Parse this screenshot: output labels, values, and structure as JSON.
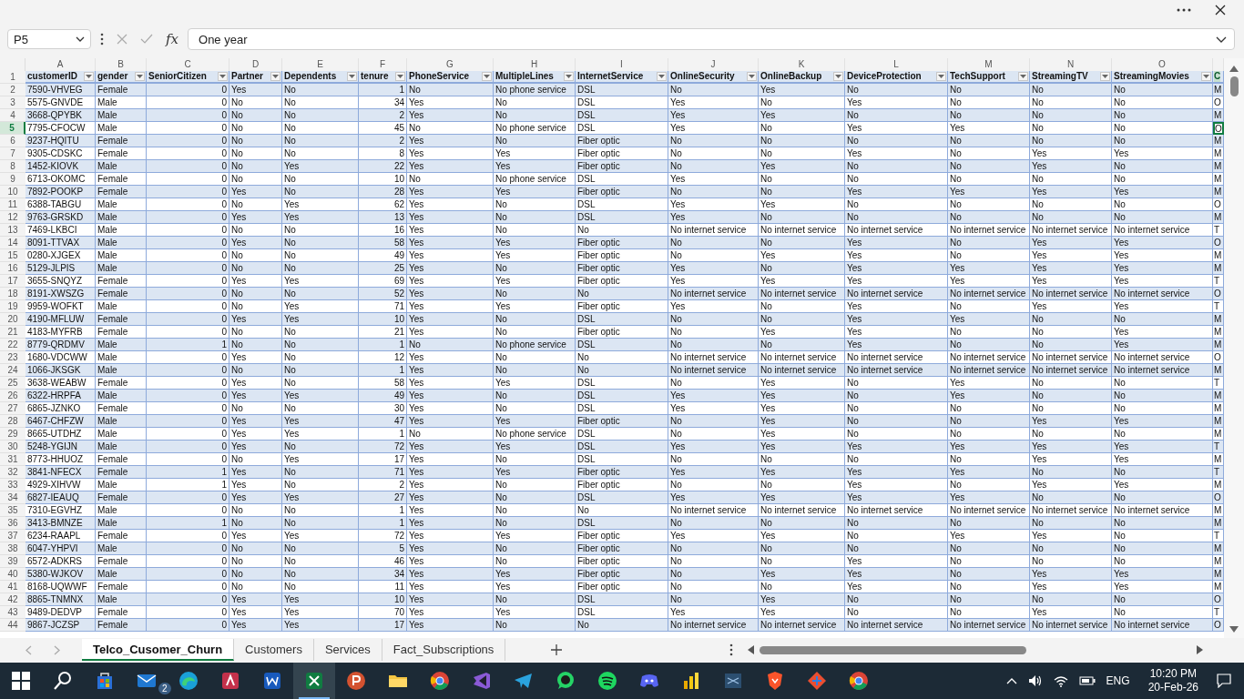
{
  "formula_bar": {
    "name_box": "P5",
    "function_label": "fx",
    "value": "One year"
  },
  "columns": [
    {
      "letter": "A",
      "header": "customerID",
      "filter_button": true,
      "selected": false
    },
    {
      "letter": "B",
      "header": "gender",
      "filter_button": true,
      "selected": false
    },
    {
      "letter": "C",
      "header": "SeniorCitizen",
      "filter_button": true,
      "selected": false
    },
    {
      "letter": "D",
      "header": "Partner",
      "filter_button": true,
      "selected": false
    },
    {
      "letter": "E",
      "header": "Dependents",
      "filter_button": true,
      "selected": false
    },
    {
      "letter": "F",
      "header": "tenure",
      "filter_button": true,
      "selected": false
    },
    {
      "letter": "G",
      "header": "PhoneService",
      "filter_button": true,
      "selected": false
    },
    {
      "letter": "H",
      "header": "MultipleLines",
      "filter_button": true,
      "selected": false
    },
    {
      "letter": "I",
      "header": "InternetService",
      "filter_button": true,
      "selected": false
    },
    {
      "letter": "J",
      "header": "OnlineSecurity",
      "filter_button": true,
      "selected": false
    },
    {
      "letter": "K",
      "header": "OnlineBackup",
      "filter_button": true,
      "selected": false
    },
    {
      "letter": "L",
      "header": "DeviceProtection",
      "filter_button": true,
      "selected": false
    },
    {
      "letter": "M",
      "header": "TechSupport",
      "filter_button": true,
      "selected": false
    },
    {
      "letter": "N",
      "header": "StreamingTV",
      "filter_button": true,
      "selected": false
    },
    {
      "letter": "O",
      "header": "StreamingMovies",
      "filter_button": true,
      "selected": false
    },
    {
      "header": "C",
      "filter_button": false,
      "selected": true
    }
  ],
  "header_row_number": "1",
  "rows": [
    {
      "number": "2",
      "selected": false,
      "cells": [
        "7590-VHVEG",
        "Female",
        "0",
        "Yes",
        "No",
        "1",
        "No",
        "No phone service",
        "DSL",
        "No",
        "Yes",
        "No",
        "No",
        "No",
        "No",
        "M"
      ]
    },
    {
      "number": "3",
      "selected": false,
      "cells": [
        "5575-GNVDE",
        "Male",
        "0",
        "No",
        "No",
        "34",
        "Yes",
        "No",
        "DSL",
        "Yes",
        "No",
        "Yes",
        "No",
        "No",
        "No",
        "O"
      ]
    },
    {
      "number": "4",
      "selected": false,
      "cells": [
        "3668-QPYBK",
        "Male",
        "0",
        "No",
        "No",
        "2",
        "Yes",
        "No",
        "DSL",
        "Yes",
        "Yes",
        "No",
        "No",
        "No",
        "No",
        "M"
      ]
    },
    {
      "number": "5",
      "selected": true,
      "cells": [
        "7795-CFOCW",
        "Male",
        "0",
        "No",
        "No",
        "45",
        "No",
        "No phone service",
        "DSL",
        "Yes",
        "No",
        "Yes",
        "Yes",
        "No",
        "No",
        "O"
      ]
    },
    {
      "number": "6",
      "selected": false,
      "cells": [
        "9237-HQITU",
        "Female",
        "0",
        "No",
        "No",
        "2",
        "Yes",
        "No",
        "Fiber optic",
        "No",
        "No",
        "No",
        "No",
        "No",
        "No",
        "M"
      ]
    },
    {
      "number": "7",
      "selected": false,
      "cells": [
        "9305-CDSKC",
        "Female",
        "0",
        "No",
        "No",
        "8",
        "Yes",
        "Yes",
        "Fiber optic",
        "No",
        "No",
        "Yes",
        "No",
        "Yes",
        "Yes",
        "M"
      ]
    },
    {
      "number": "8",
      "selected": false,
      "cells": [
        "1452-KIOVK",
        "Male",
        "0",
        "No",
        "Yes",
        "22",
        "Yes",
        "Yes",
        "Fiber optic",
        "No",
        "Yes",
        "No",
        "No",
        "Yes",
        "No",
        "M"
      ]
    },
    {
      "number": "9",
      "selected": false,
      "cells": [
        "6713-OKOMC",
        "Female",
        "0",
        "No",
        "No",
        "10",
        "No",
        "No phone service",
        "DSL",
        "Yes",
        "No",
        "No",
        "No",
        "No",
        "No",
        "M"
      ]
    },
    {
      "number": "10",
      "selected": false,
      "cells": [
        "7892-POOKP",
        "Female",
        "0",
        "Yes",
        "No",
        "28",
        "Yes",
        "Yes",
        "Fiber optic",
        "No",
        "No",
        "Yes",
        "Yes",
        "Yes",
        "Yes",
        "M"
      ]
    },
    {
      "number": "11",
      "selected": false,
      "cells": [
        "6388-TABGU",
        "Male",
        "0",
        "No",
        "Yes",
        "62",
        "Yes",
        "No",
        "DSL",
        "Yes",
        "Yes",
        "No",
        "No",
        "No",
        "No",
        "O"
      ]
    },
    {
      "number": "12",
      "selected": false,
      "cells": [
        "9763-GRSKD",
        "Male",
        "0",
        "Yes",
        "Yes",
        "13",
        "Yes",
        "No",
        "DSL",
        "Yes",
        "No",
        "No",
        "No",
        "No",
        "No",
        "M"
      ]
    },
    {
      "number": "13",
      "selected": false,
      "cells": [
        "7469-LKBCI",
        "Male",
        "0",
        "No",
        "No",
        "16",
        "Yes",
        "No",
        "No",
        "No internet service",
        "No internet service",
        "No internet service",
        "No internet service",
        "No internet service",
        "No internet service",
        "T"
      ]
    },
    {
      "number": "14",
      "selected": false,
      "cells": [
        "8091-TTVAX",
        "Male",
        "0",
        "Yes",
        "No",
        "58",
        "Yes",
        "Yes",
        "Fiber optic",
        "No",
        "No",
        "Yes",
        "No",
        "Yes",
        "Yes",
        "O"
      ]
    },
    {
      "number": "15",
      "selected": false,
      "cells": [
        "0280-XJGEX",
        "Male",
        "0",
        "No",
        "No",
        "49",
        "Yes",
        "Yes",
        "Fiber optic",
        "No",
        "Yes",
        "Yes",
        "No",
        "Yes",
        "Yes",
        "M"
      ]
    },
    {
      "number": "16",
      "selected": false,
      "cells": [
        "5129-JLPIS",
        "Male",
        "0",
        "No",
        "No",
        "25",
        "Yes",
        "No",
        "Fiber optic",
        "Yes",
        "No",
        "Yes",
        "Yes",
        "Yes",
        "Yes",
        "M"
      ]
    },
    {
      "number": "17",
      "selected": false,
      "cells": [
        "3655-SNQYZ",
        "Female",
        "0",
        "Yes",
        "Yes",
        "69",
        "Yes",
        "Yes",
        "Fiber optic",
        "Yes",
        "Yes",
        "Yes",
        "Yes",
        "Yes",
        "Yes",
        "T"
      ]
    },
    {
      "number": "18",
      "selected": false,
      "cells": [
        "8191-XWSZG",
        "Female",
        "0",
        "No",
        "No",
        "52",
        "Yes",
        "No",
        "No",
        "No internet service",
        "No internet service",
        "No internet service",
        "No internet service",
        "No internet service",
        "No internet service",
        "O"
      ]
    },
    {
      "number": "19",
      "selected": false,
      "cells": [
        "9959-WOFKT",
        "Male",
        "0",
        "No",
        "Yes",
        "71",
        "Yes",
        "Yes",
        "Fiber optic",
        "Yes",
        "No",
        "Yes",
        "No",
        "Yes",
        "Yes",
        "T"
      ]
    },
    {
      "number": "20",
      "selected": false,
      "cells": [
        "4190-MFLUW",
        "Female",
        "0",
        "Yes",
        "Yes",
        "10",
        "Yes",
        "No",
        "DSL",
        "No",
        "No",
        "Yes",
        "Yes",
        "No",
        "No",
        "M"
      ]
    },
    {
      "number": "21",
      "selected": false,
      "cells": [
        "4183-MYFRB",
        "Female",
        "0",
        "No",
        "No",
        "21",
        "Yes",
        "No",
        "Fiber optic",
        "No",
        "Yes",
        "Yes",
        "No",
        "No",
        "Yes",
        "M"
      ]
    },
    {
      "number": "22",
      "selected": false,
      "cells": [
        "8779-QRDMV",
        "Male",
        "1",
        "No",
        "No",
        "1",
        "No",
        "No phone service",
        "DSL",
        "No",
        "No",
        "Yes",
        "No",
        "No",
        "Yes",
        "M"
      ]
    },
    {
      "number": "23",
      "selected": false,
      "cells": [
        "1680-VDCWW",
        "Male",
        "0",
        "Yes",
        "No",
        "12",
        "Yes",
        "No",
        "No",
        "No internet service",
        "No internet service",
        "No internet service",
        "No internet service",
        "No internet service",
        "No internet service",
        "O"
      ]
    },
    {
      "number": "24",
      "selected": false,
      "cells": [
        "1066-JKSGK",
        "Male",
        "0",
        "No",
        "No",
        "1",
        "Yes",
        "No",
        "No",
        "No internet service",
        "No internet service",
        "No internet service",
        "No internet service",
        "No internet service",
        "No internet service",
        "M"
      ]
    },
    {
      "number": "25",
      "selected": false,
      "cells": [
        "3638-WEABW",
        "Female",
        "0",
        "Yes",
        "No",
        "58",
        "Yes",
        "Yes",
        "DSL",
        "No",
        "Yes",
        "No",
        "Yes",
        "No",
        "No",
        "T"
      ]
    },
    {
      "number": "26",
      "selected": false,
      "cells": [
        "6322-HRPFA",
        "Male",
        "0",
        "Yes",
        "Yes",
        "49",
        "Yes",
        "No",
        "DSL",
        "Yes",
        "Yes",
        "No",
        "Yes",
        "No",
        "No",
        "M"
      ]
    },
    {
      "number": "27",
      "selected": false,
      "cells": [
        "6865-JZNKO",
        "Female",
        "0",
        "No",
        "No",
        "30",
        "Yes",
        "No",
        "DSL",
        "Yes",
        "Yes",
        "No",
        "No",
        "No",
        "No",
        "M"
      ]
    },
    {
      "number": "28",
      "selected": false,
      "cells": [
        "6467-CHFZW",
        "Male",
        "0",
        "Yes",
        "Yes",
        "47",
        "Yes",
        "Yes",
        "Fiber optic",
        "No",
        "Yes",
        "No",
        "No",
        "Yes",
        "Yes",
        "M"
      ]
    },
    {
      "number": "29",
      "selected": false,
      "cells": [
        "8665-UTDHZ",
        "Male",
        "0",
        "Yes",
        "Yes",
        "1",
        "No",
        "No phone service",
        "DSL",
        "No",
        "Yes",
        "No",
        "No",
        "No",
        "No",
        "M"
      ]
    },
    {
      "number": "30",
      "selected": false,
      "cells": [
        "5248-YGIJN",
        "Male",
        "0",
        "Yes",
        "No",
        "72",
        "Yes",
        "Yes",
        "DSL",
        "Yes",
        "Yes",
        "Yes",
        "Yes",
        "Yes",
        "Yes",
        "T"
      ]
    },
    {
      "number": "31",
      "selected": false,
      "cells": [
        "8773-HHUOZ",
        "Female",
        "0",
        "No",
        "Yes",
        "17",
        "Yes",
        "No",
        "DSL",
        "No",
        "No",
        "No",
        "No",
        "Yes",
        "Yes",
        "M"
      ]
    },
    {
      "number": "32",
      "selected": false,
      "cells": [
        "3841-NFECX",
        "Female",
        "1",
        "Yes",
        "No",
        "71",
        "Yes",
        "Yes",
        "Fiber optic",
        "Yes",
        "Yes",
        "Yes",
        "Yes",
        "No",
        "No",
        "T"
      ]
    },
    {
      "number": "33",
      "selected": false,
      "cells": [
        "4929-XIHVW",
        "Male",
        "1",
        "Yes",
        "No",
        "2",
        "Yes",
        "No",
        "Fiber optic",
        "No",
        "No",
        "Yes",
        "No",
        "Yes",
        "Yes",
        "M"
      ]
    },
    {
      "number": "34",
      "selected": false,
      "cells": [
        "6827-IEAUQ",
        "Female",
        "0",
        "Yes",
        "Yes",
        "27",
        "Yes",
        "No",
        "DSL",
        "Yes",
        "Yes",
        "Yes",
        "Yes",
        "No",
        "No",
        "O"
      ]
    },
    {
      "number": "35",
      "selected": false,
      "cells": [
        "7310-EGVHZ",
        "Male",
        "0",
        "No",
        "No",
        "1",
        "Yes",
        "No",
        "No",
        "No internet service",
        "No internet service",
        "No internet service",
        "No internet service",
        "No internet service",
        "No internet service",
        "M"
      ]
    },
    {
      "number": "36",
      "selected": false,
      "cells": [
        "3413-BMNZE",
        "Male",
        "1",
        "No",
        "No",
        "1",
        "Yes",
        "No",
        "DSL",
        "No",
        "No",
        "No",
        "No",
        "No",
        "No",
        "M"
      ]
    },
    {
      "number": "37",
      "selected": false,
      "cells": [
        "6234-RAAPL",
        "Female",
        "0",
        "Yes",
        "Yes",
        "72",
        "Yes",
        "Yes",
        "Fiber optic",
        "Yes",
        "Yes",
        "No",
        "Yes",
        "Yes",
        "No",
        "T"
      ]
    },
    {
      "number": "38",
      "selected": false,
      "cells": [
        "6047-YHPVI",
        "Male",
        "0",
        "No",
        "No",
        "5",
        "Yes",
        "No",
        "Fiber optic",
        "No",
        "No",
        "No",
        "No",
        "No",
        "No",
        "M"
      ]
    },
    {
      "number": "39",
      "selected": false,
      "cells": [
        "6572-ADKRS",
        "Female",
        "0",
        "No",
        "No",
        "46",
        "Yes",
        "No",
        "Fiber optic",
        "No",
        "No",
        "Yes",
        "No",
        "No",
        "No",
        "M"
      ]
    },
    {
      "number": "40",
      "selected": false,
      "cells": [
        "5380-WJKOV",
        "Male",
        "0",
        "No",
        "No",
        "34",
        "Yes",
        "Yes",
        "Fiber optic",
        "No",
        "Yes",
        "Yes",
        "No",
        "Yes",
        "Yes",
        "M"
      ]
    },
    {
      "number": "41",
      "selected": false,
      "cells": [
        "8168-UQWWF",
        "Female",
        "0",
        "No",
        "No",
        "11",
        "Yes",
        "Yes",
        "Fiber optic",
        "No",
        "No",
        "Yes",
        "No",
        "Yes",
        "Yes",
        "M"
      ]
    },
    {
      "number": "42",
      "selected": false,
      "cells": [
        "8865-TNMNX",
        "Male",
        "0",
        "Yes",
        "Yes",
        "10",
        "Yes",
        "No",
        "DSL",
        "No",
        "Yes",
        "No",
        "No",
        "No",
        "No",
        "O"
      ]
    },
    {
      "number": "43",
      "selected": false,
      "cells": [
        "9489-DEDVP",
        "Female",
        "0",
        "Yes",
        "Yes",
        "70",
        "Yes",
        "Yes",
        "DSL",
        "Yes",
        "Yes",
        "No",
        "No",
        "Yes",
        "No",
        "T"
      ]
    },
    {
      "number": "44",
      "selected": false,
      "cells": [
        "9867-JCZSP",
        "Female",
        "0",
        "Yes",
        "Yes",
        "17",
        "Yes",
        "No",
        "No",
        "No internet service",
        "No internet service",
        "No internet service",
        "No internet service",
        "No internet service",
        "No internet service",
        "O"
      ]
    }
  ],
  "sheet_tabs": [
    {
      "label": "Telco_Cusomer_Churn",
      "selected": true
    },
    {
      "label": "Customers",
      "selected": false
    },
    {
      "label": "Services",
      "selected": false
    },
    {
      "label": "Fact_Subscriptions",
      "selected": false
    }
  ],
  "taskbar": {
    "apps": [
      {
        "kind": "windows",
        "selected": false
      },
      {
        "kind": "search",
        "selected": false
      },
      {
        "kind": "store",
        "selected": false
      },
      {
        "kind": "mail",
        "selected": false,
        "badge": "2"
      },
      {
        "kind": "edge",
        "selected": false
      },
      {
        "kind": "access",
        "selected": false
      },
      {
        "kind": "word",
        "selected": false
      },
      {
        "kind": "excel",
        "selected": true
      },
      {
        "kind": "powerpoint",
        "selected": false
      },
      {
        "kind": "folder",
        "selected": false
      },
      {
        "kind": "chrome",
        "selected": false
      },
      {
        "kind": "studio",
        "selected": false
      },
      {
        "kind": "telegram",
        "selected": false
      },
      {
        "kind": "whatsapp",
        "selected": false
      },
      {
        "kind": "spotify",
        "selected": false
      },
      {
        "kind": "discord",
        "selected": false
      },
      {
        "kind": "powerbi",
        "selected": false
      },
      {
        "kind": "sql",
        "selected": false
      },
      {
        "kind": "brave",
        "selected": false
      },
      {
        "kind": "git",
        "selected": false
      },
      {
        "kind": "chrome",
        "selected": false
      }
    ],
    "language": "ENG",
    "time": "10:20 PM",
    "date": "20-Feb-26"
  }
}
